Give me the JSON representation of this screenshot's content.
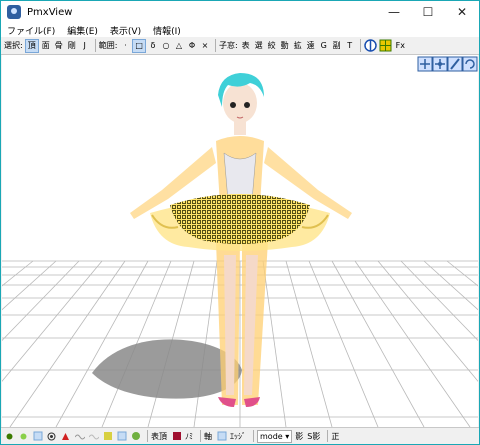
{
  "window": {
    "title": "PmxView",
    "controls": {
      "minimize": "—",
      "maximize": "☐",
      "close": "✕"
    }
  },
  "menu": {
    "items": [
      "ファイル(F)",
      "編集(E)",
      "表示(V)",
      "情報(I)"
    ]
  },
  "toolbar": {
    "select_label": "選択:",
    "select_buttons": [
      "頂",
      "面",
      "骨",
      "剛",
      "J"
    ],
    "range_label": "範囲:",
    "range_buttons": [
      "·",
      "□",
      "δ",
      "○",
      "△",
      "Φ",
      "×"
    ],
    "child_label": "子窓:",
    "child_buttons": [
      "表",
      "選",
      "絞",
      "動",
      "拡",
      "遠",
      "G",
      "副",
      "T"
    ],
    "fx_label": "Fx"
  },
  "statusbar": {
    "buttons": [
      "表頂",
      "ﾉﾐ",
      "軸",
      "ｴｯｼﾞ",
      "影",
      "S影",
      "正"
    ],
    "mode_label": "mode"
  },
  "colors": {
    "accent": "#1aa7b5",
    "bone_overlay": "#ffcf70",
    "selection_marker": "#e8e000",
    "hair": "#3fd0d8",
    "shoes": "#e0508a"
  }
}
